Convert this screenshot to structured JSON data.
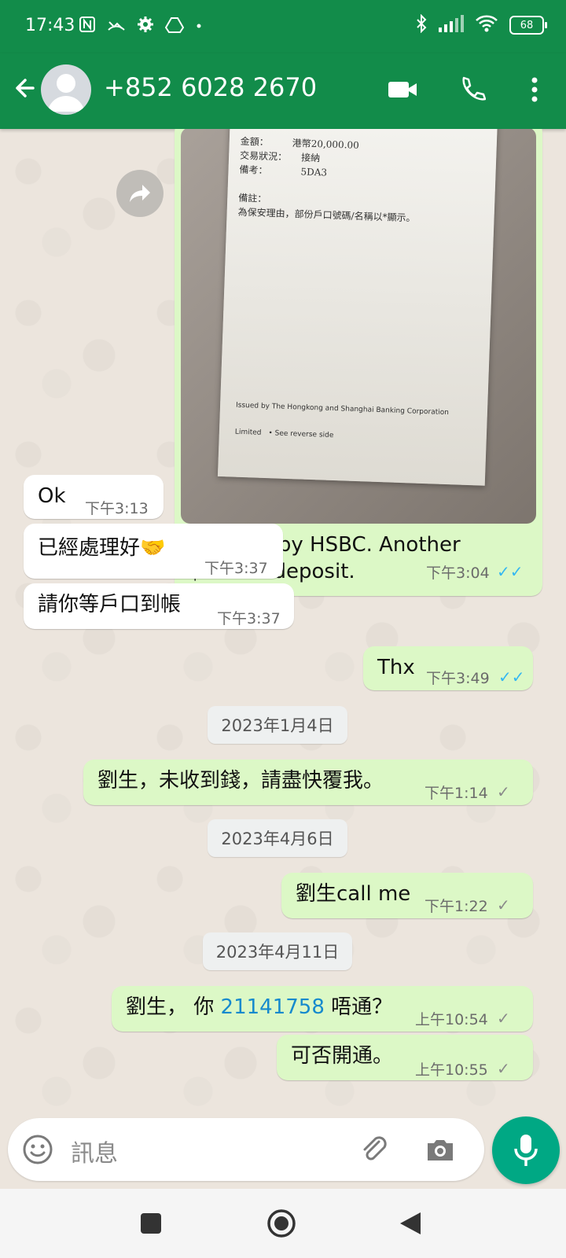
{
  "status_bar": {
    "time": "17:43",
    "battery": "68",
    "left_icons": [
      "nfc-icon",
      "missed-call-icon",
      "settings-icon",
      "drive-icon",
      "dot-icon"
    ],
    "right_icons": [
      "bluetooth-icon",
      "signal-icon",
      "wifi-icon",
      "battery-icon"
    ]
  },
  "app_bar": {
    "contact_name": "+852 6028 2670",
    "actions": [
      "video-call-icon",
      "voice-call-icon",
      "more-options-icon"
    ]
  },
  "messages": {
    "image_message": {
      "receipt_lines": [
        "金額：　　　港幣20,000.00",
        "交易狀況：　　接納",
        "備考：　　　　5DA3",
        "",
        "備註：",
        "為保安理由，部份戶口號碼/名稱以*顯示。"
      ],
      "receipt_footer": "Issued by The Hongkong and Shanghai Banking Corporation Limited　• See reverse side",
      "caption": "Request by HSBC. Another $20000 deposit.",
      "time": "下午3:04"
    },
    "m1": {
      "text": "Ok",
      "time": "下午3:13"
    },
    "m2": {
      "text": "已經處理好🤝",
      "time": "下午3:37"
    },
    "m3": {
      "text": "請你等戶口到帳",
      "time": "下午3:37"
    },
    "m4": {
      "text": "Thx",
      "time": "下午3:49"
    },
    "date1": "2023年1月4日",
    "m5": {
      "text": "劉生，未收到錢，請盡快覆我。",
      "time": "下午1:14"
    },
    "date2": "2023年4月6日",
    "m6": {
      "text": "劉生call me",
      "time": "下午1:22"
    },
    "date3": "2023年4月11日",
    "m7": {
      "prefix": "劉生， 你 ",
      "link": "21141758",
      "suffix": " 唔通？",
      "time": "上午10:54"
    },
    "m8": {
      "text": "可否開通。",
      "time": "上午10:55"
    }
  },
  "composer": {
    "placeholder": "訊息"
  },
  "colors": {
    "header_green": "#128c4a",
    "outgoing_bubble": "#dcf8c6",
    "incoming_bubble": "#ffffff",
    "read_tick": "#34b7f1",
    "mic_button": "#00a884"
  }
}
